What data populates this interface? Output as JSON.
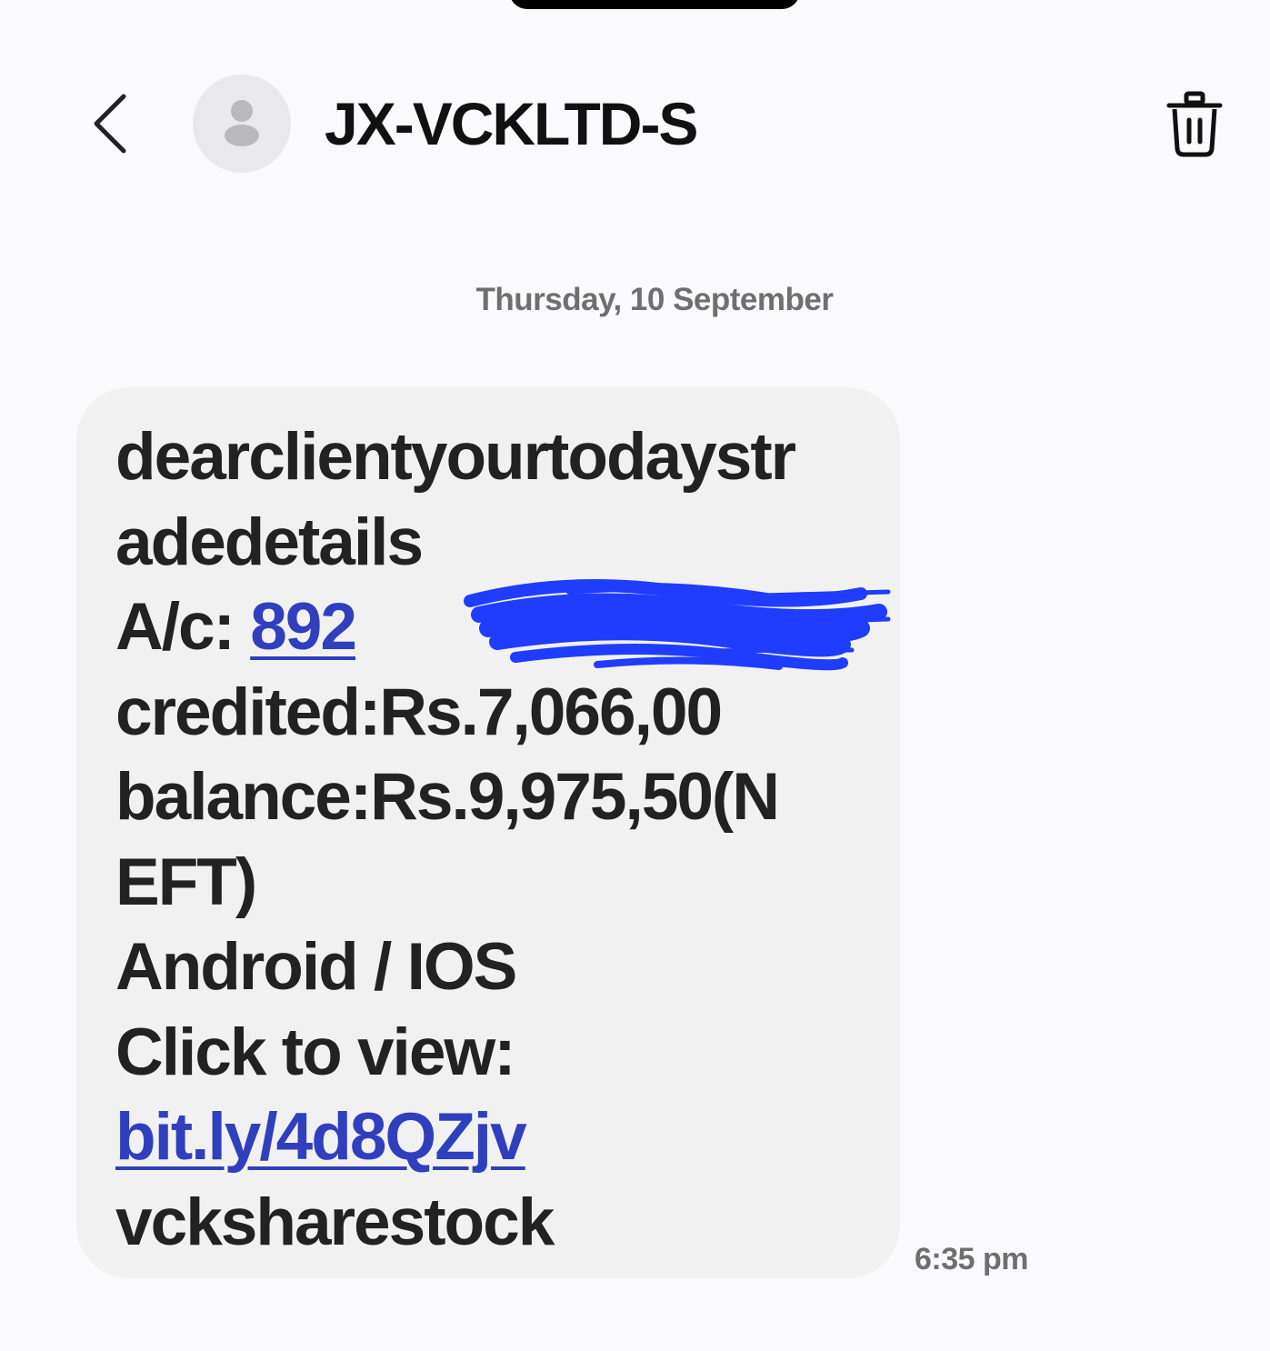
{
  "header": {
    "contact_name": "JX-VCKLTD-S"
  },
  "conversation": {
    "date_separator": "Thursday, 10 September",
    "message": {
      "line1": "dearclientyourtodaystr",
      "line2": "adedetails",
      "account_label": "A/c: ",
      "account_number_visible": "892",
      "line4": "credited:Rs.7,066,00",
      "line5": "balance:Rs.9,975,50(N",
      "line6": "EFT)",
      "line7": "Android / IOS",
      "line8": "Click to view:",
      "link": "bit.ly/4d8QZjv",
      "line10": "vcksharestock",
      "time": "6:35 pm"
    }
  },
  "colors": {
    "background": "#fafafc",
    "bubble": "#f1f1f2",
    "link": "#2f3fbd",
    "redaction": "#1f3cff"
  },
  "icons": {
    "back": "chevron-left-icon",
    "avatar": "person-icon",
    "delete": "trash-icon"
  }
}
